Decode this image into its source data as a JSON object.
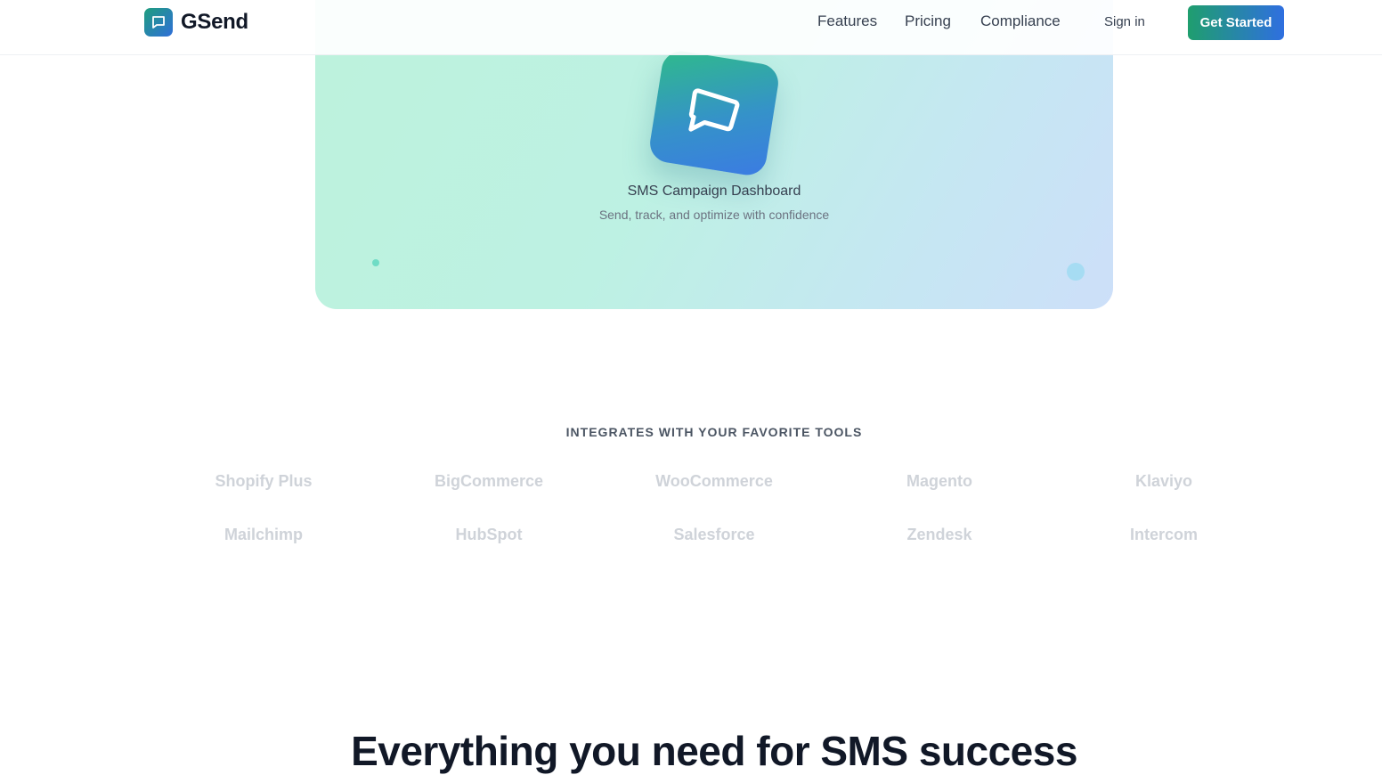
{
  "brand": {
    "name": "GSend",
    "icon": "chat-bubble-icon",
    "colors": {
      "accent_start": "#1f9e6e",
      "accent_end": "#2f6fe0"
    }
  },
  "nav": {
    "links": [
      "Features",
      "Pricing",
      "Compliance"
    ],
    "sign_in": "Sign in",
    "cta": "Get Started"
  },
  "hero": {
    "icon": "chat-bubble-icon",
    "title": "SMS Campaign Dashboard",
    "subtitle": "Send, track, and optimize with confidence"
  },
  "integrations": {
    "heading": "INTEGRATES WITH YOUR FAVORITE TOOLS",
    "items": [
      "Shopify Plus",
      "BigCommerce",
      "WooCommerce",
      "Magento",
      "Klaviyo",
      "Mailchimp",
      "HubSpot",
      "Salesforce",
      "Zendesk",
      "Intercom"
    ]
  },
  "features": {
    "heading": "Everything you need for SMS success"
  }
}
